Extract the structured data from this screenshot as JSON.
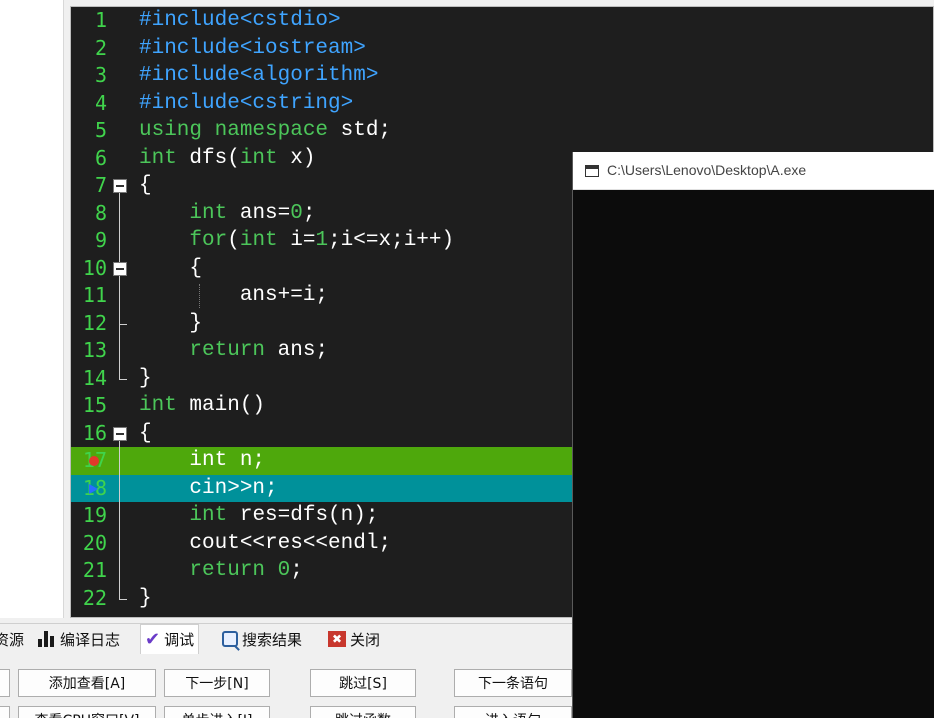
{
  "editor": {
    "lines": [
      {
        "num": "1",
        "segments": [
          {
            "t": "#include<cstdio>",
            "c": "pre"
          }
        ]
      },
      {
        "num": "2",
        "segments": [
          {
            "t": "#include<iostream>",
            "c": "pre"
          }
        ]
      },
      {
        "num": "3",
        "segments": [
          {
            "t": "#include<algorithm>",
            "c": "pre"
          }
        ]
      },
      {
        "num": "4",
        "segments": [
          {
            "t": "#include<cstring>",
            "c": "pre"
          }
        ]
      },
      {
        "num": "5",
        "segments": [
          {
            "t": "using namespace",
            "c": "kw"
          },
          {
            "t": " std;",
            "c": ""
          }
        ]
      },
      {
        "num": "6",
        "segments": [
          {
            "t": "int",
            "c": "kw"
          },
          {
            "t": " dfs(",
            "c": ""
          },
          {
            "t": "int",
            "c": "kw"
          },
          {
            "t": " x)",
            "c": ""
          }
        ]
      },
      {
        "num": "7",
        "segments": [
          {
            "t": "{",
            "c": ""
          }
        ]
      },
      {
        "num": "8",
        "segments": [
          {
            "t": "    ",
            "c": ""
          },
          {
            "t": "int",
            "c": "kw"
          },
          {
            "t": " ans=",
            "c": ""
          },
          {
            "t": "0",
            "c": "num"
          },
          {
            "t": ";",
            "c": ""
          }
        ]
      },
      {
        "num": "9",
        "segments": [
          {
            "t": "    ",
            "c": ""
          },
          {
            "t": "for",
            "c": "kw"
          },
          {
            "t": "(",
            "c": ""
          },
          {
            "t": "int",
            "c": "kw"
          },
          {
            "t": " i=",
            "c": ""
          },
          {
            "t": "1",
            "c": "num"
          },
          {
            "t": ";i<=x;i++)",
            "c": ""
          }
        ]
      },
      {
        "num": "10",
        "segments": [
          {
            "t": "    {",
            "c": ""
          }
        ]
      },
      {
        "num": "11",
        "segments": [
          {
            "t": "        ans+=i;",
            "c": ""
          }
        ]
      },
      {
        "num": "12",
        "segments": [
          {
            "t": "    }",
            "c": ""
          }
        ]
      },
      {
        "num": "13",
        "segments": [
          {
            "t": "    ",
            "c": ""
          },
          {
            "t": "return",
            "c": "kw"
          },
          {
            "t": " ans;",
            "c": ""
          }
        ]
      },
      {
        "num": "14",
        "segments": [
          {
            "t": "}",
            "c": ""
          }
        ]
      },
      {
        "num": "15",
        "segments": [
          {
            "t": "int",
            "c": "kw"
          },
          {
            "t": " main()",
            "c": ""
          }
        ]
      },
      {
        "num": "16",
        "segments": [
          {
            "t": "{",
            "c": ""
          }
        ]
      },
      {
        "num": "17",
        "segments": [
          {
            "t": "    int n;",
            "c": ""
          }
        ],
        "highlight": "breakpoint"
      },
      {
        "num": "18",
        "segments": [
          {
            "t": "    cin>>n;",
            "c": ""
          }
        ],
        "highlight": "current"
      },
      {
        "num": "19",
        "segments": [
          {
            "t": "    ",
            "c": ""
          },
          {
            "t": "int",
            "c": "kw"
          },
          {
            "t": " res=dfs(n);",
            "c": ""
          }
        ]
      },
      {
        "num": "20",
        "segments": [
          {
            "t": "    cout<<res<<endl;",
            "c": ""
          }
        ]
      },
      {
        "num": "21",
        "segments": [
          {
            "t": "    ",
            "c": ""
          },
          {
            "t": "return",
            "c": "kw"
          },
          {
            "t": " ",
            "c": ""
          },
          {
            "t": "0",
            "c": "num"
          },
          {
            "t": ";",
            "c": ""
          }
        ]
      },
      {
        "num": "22",
        "segments": [
          {
            "t": "}",
            "c": ""
          }
        ]
      }
    ],
    "colors": {
      "background": "#1e1e1e",
      "line_numbers": "#40d44c",
      "preprocessor": "#3fa4ff",
      "keyword": "#4cc65a",
      "breakpoint_line": "#4ea80c",
      "current_line": "#00919a"
    },
    "fold_markers": [
      "7",
      "10",
      "16"
    ]
  },
  "console": {
    "title": "C:\\Users\\Lenovo\\Desktop\\A.exe"
  },
  "tabs": [
    {
      "label": "资源",
      "icon": "resources-icon"
    },
    {
      "label": "编译日志",
      "icon": "chart-icon"
    },
    {
      "label": "调试",
      "icon": "check-icon",
      "active": true
    },
    {
      "label": "搜索结果",
      "icon": "search-icon"
    },
    {
      "label": "关闭",
      "icon": "close-icon"
    }
  ],
  "buttons": {
    "row1": [
      "添加查看[A]",
      "下一步[N]",
      "跳过[S]",
      "下一条语句"
    ],
    "row2": [
      "查看CPU窗口[V]",
      "单步进入[I]",
      "跳过函数",
      "进入语句"
    ]
  }
}
